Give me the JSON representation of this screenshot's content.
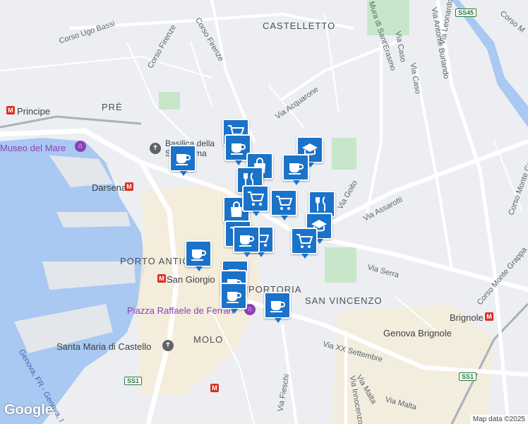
{
  "map": {
    "districts": [
      {
        "id": "castelletto",
        "text": "CASTELLETTO"
      },
      {
        "id": "pre",
        "text": "PRÈ"
      },
      {
        "id": "portoria",
        "text": "PORTORIA"
      },
      {
        "id": "san-vincenzo",
        "text": "SAN VINCENZO"
      },
      {
        "id": "molo",
        "text": "MOLO"
      },
      {
        "id": "porto-antico",
        "text": "PORTO ANTICO"
      }
    ],
    "streets": [
      {
        "id": "corso-ugo-bassi",
        "text": "Corso Ugo Bassi"
      },
      {
        "id": "corso-firenze-1",
        "text": "Corso Firenze"
      },
      {
        "id": "corso-firenze-2",
        "text": "Corso Firenze"
      },
      {
        "id": "mura-santerasmo",
        "text": "Mura di Sant'Erasmo"
      },
      {
        "id": "via-caso",
        "text": "Via Caso"
      },
      {
        "id": "via-caso-2",
        "text": "Via Caso"
      },
      {
        "id": "via-burlando",
        "text": "Via Antonio Burlando"
      },
      {
        "id": "via-leonardo",
        "text": "Via Leonardo"
      },
      {
        "id": "corso-m",
        "text": "Corso M"
      },
      {
        "id": "via-acquarone",
        "text": "Via Acquarone"
      },
      {
        "id": "via-goito",
        "text": "Via Goito"
      },
      {
        "id": "via-assarotti",
        "text": "Via Assarotti"
      },
      {
        "id": "via-serra",
        "text": "Via Serra"
      },
      {
        "id": "corso-monte-grappa-1",
        "text": "Corso Monte Grappa"
      },
      {
        "id": "corso-monte-grappa-2",
        "text": "Corso Monte Grappa"
      },
      {
        "id": "via-xx-settembre",
        "text": "Via XX Settembre"
      },
      {
        "id": "via-fieschi",
        "text": "Via Fieschi"
      },
      {
        "id": "via-innocenzo",
        "text": "Via Innocenzo"
      },
      {
        "id": "via-malta",
        "text": "Via Malta"
      },
      {
        "id": "via-malta-2",
        "text": "Via Malta"
      },
      {
        "id": "genova-coast",
        "text": "Genova, FR - Genova, I"
      }
    ],
    "places": [
      {
        "id": "principe",
        "text": "Principe"
      },
      {
        "id": "museo-del-mare",
        "text": "Museo del Mare"
      },
      {
        "id": "darsena",
        "text": "Darsena"
      },
      {
        "id": "basilica",
        "text": "Basilica della Santissima Annunziata del..."
      },
      {
        "id": "san-giorgio",
        "text": "San Giorgio"
      },
      {
        "id": "piazza-de-ferrari",
        "text": "Piazza Raffaele de Ferrari"
      },
      {
        "id": "santa-maria-castello",
        "text": "Santa Maria di Castello"
      },
      {
        "id": "genova-brignole",
        "text": "Genova Brignole"
      },
      {
        "id": "brignole",
        "text": "Brignole"
      }
    ],
    "road_shields": [
      "SS45",
      "SS1",
      "SS1"
    ],
    "metro_glyph": "M",
    "logo": "Google",
    "attribution": "Map data ©2025"
  },
  "markers": [
    {
      "kind": "cafe"
    },
    {
      "kind": "cafe"
    },
    {
      "kind": "shopping-cart"
    },
    {
      "kind": "cafe"
    },
    {
      "kind": "shopping-bag"
    },
    {
      "kind": "restaurant"
    },
    {
      "kind": "school"
    },
    {
      "kind": "cafe"
    },
    {
      "kind": "shopping-cart"
    },
    {
      "kind": "restaurant"
    },
    {
      "kind": "shopping-bag"
    },
    {
      "kind": "shopping-cart"
    },
    {
      "kind": "school"
    },
    {
      "kind": "shopping-cart"
    },
    {
      "kind": "shopping-cart"
    },
    {
      "kind": "shopping-cart"
    },
    {
      "kind": "cafe"
    },
    {
      "kind": "cafe"
    },
    {
      "kind": "cafe"
    },
    {
      "kind": "cafe"
    },
    {
      "kind": "cafe"
    }
  ],
  "colors": {
    "marker": "#1a73c9",
    "water": "#a9c8f2",
    "park": "#c8e6c9",
    "metro": "#d93025",
    "poi_purple": "#8e3fb8"
  }
}
